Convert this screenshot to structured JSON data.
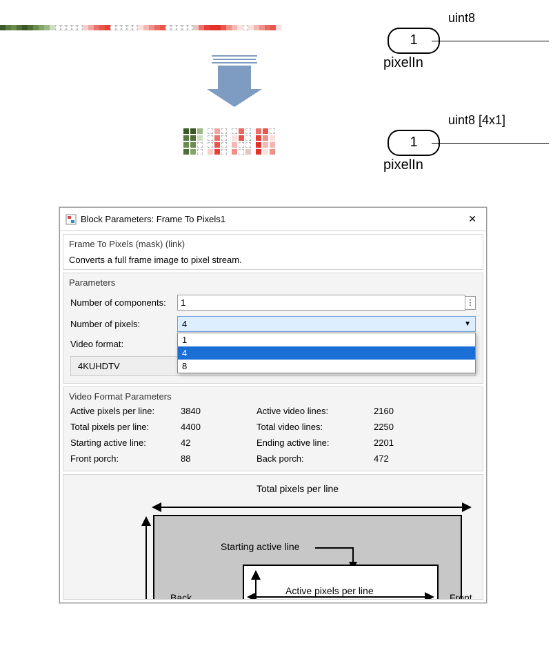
{
  "ports": {
    "p1": {
      "num": "1",
      "label": "pixelIn",
      "type": "uint8"
    },
    "p2": {
      "num": "1",
      "label": "pixelIn",
      "type": "uint8 [4x1]"
    }
  },
  "dialog": {
    "title": "Block Parameters: Frame To Pixels1",
    "maskheader": "Frame To Pixels (mask) (link)",
    "maskdesc": "Converts a full frame image to pixel stream.",
    "params_section": "Parameters",
    "numcomp_label": "Number of components:",
    "numcomp_value": "1",
    "numpix_label": "Number of pixels:",
    "numpix_selected": "4",
    "numpix_options": [
      "1",
      "4",
      "8"
    ],
    "vidfmt_label": "Video format:",
    "vidfmt_value": "4KUHDTV",
    "vfp_section": "Video Format Parameters",
    "vfp": {
      "apl_l": "Active pixels per line:",
      "apl_v": "3840",
      "avl_l": "Active video lines:",
      "avl_v": "2160",
      "tpl_l": "Total pixels per line:",
      "tpl_v": "4400",
      "tvl_l": "Total video lines:",
      "tvl_v": "2250",
      "sal_l": "Starting active line:",
      "sal_v": "42",
      "eal_l": "Ending active line:",
      "eal_v": "2201",
      "fp_l": "Front porch:",
      "fp_v": "88",
      "bp_l": "Back porch:",
      "bp_v": "472"
    },
    "diagram": {
      "total": "Total pixels per line",
      "start": "Starting active line",
      "active": "Active pixels per line",
      "back": "Back",
      "front": "Front"
    }
  },
  "strip_colors": [
    "#3b5a27",
    "#597b3f",
    "#6a8c4f",
    "#4e6d37",
    "#3a5626",
    "#4e6d37",
    "#6a8c4f",
    "#82a467",
    "#9bb887",
    "#cddfc1",
    "empty",
    "empty",
    "empty",
    "empty",
    "empty",
    "#f8cecb",
    "#f2a59f",
    "#ea726a",
    "#e9544b",
    "#e84038",
    "empty",
    "empty",
    "empty",
    "empty",
    "empty",
    "#fbe0de",
    "#f4b7b2",
    "#ee8f88",
    "#ea6a62",
    "#e9544b",
    "empty",
    "empty",
    "empty",
    "empty",
    "empty",
    "#e9c5c2",
    "#ea726a",
    "#e84038",
    "#e33228",
    "#e33228",
    "#e9544b",
    "#ee8f88",
    "#f4b7b2",
    "#fbe0de",
    "empty",
    "#fbe0de",
    "#f4b7b2",
    "#ee8f88",
    "#ea6a62",
    "#e9544b",
    "#fbe0de"
  ],
  "strip4_colors": [
    [
      "#3b5a27",
      "#597b3f",
      "#6a8c4f",
      "#4e6d37"
    ],
    [
      "#3a5626",
      "#4e6d37",
      "#6a8c4f",
      "#82a467"
    ],
    [
      "#9bb887",
      "#cddfc1",
      "empty",
      "empty"
    ],
    "gap",
    [
      "empty",
      "empty",
      "empty",
      "#f8cecb"
    ],
    [
      "#f2a59f",
      "#ea726a",
      "#e9544b",
      "#e84038"
    ],
    [
      "empty",
      "empty",
      "empty",
      "empty"
    ],
    "gap",
    [
      "empty",
      "#fbe0de",
      "#f4b7b2",
      "#ee8f88"
    ],
    [
      "#ea6a62",
      "#e9544b",
      "empty",
      "empty"
    ],
    [
      "empty",
      "empty",
      "empty",
      "#e9c5c2"
    ],
    "gap",
    [
      "#ea726a",
      "#e84038",
      "#e33228",
      "#e33228"
    ],
    [
      "#e9544b",
      "#ee8f88",
      "#f4b7b2",
      "#fbe0de"
    ],
    [
      "empty",
      "#fbe0de",
      "#f4b7b2",
      "#ee8f88"
    ]
  ]
}
